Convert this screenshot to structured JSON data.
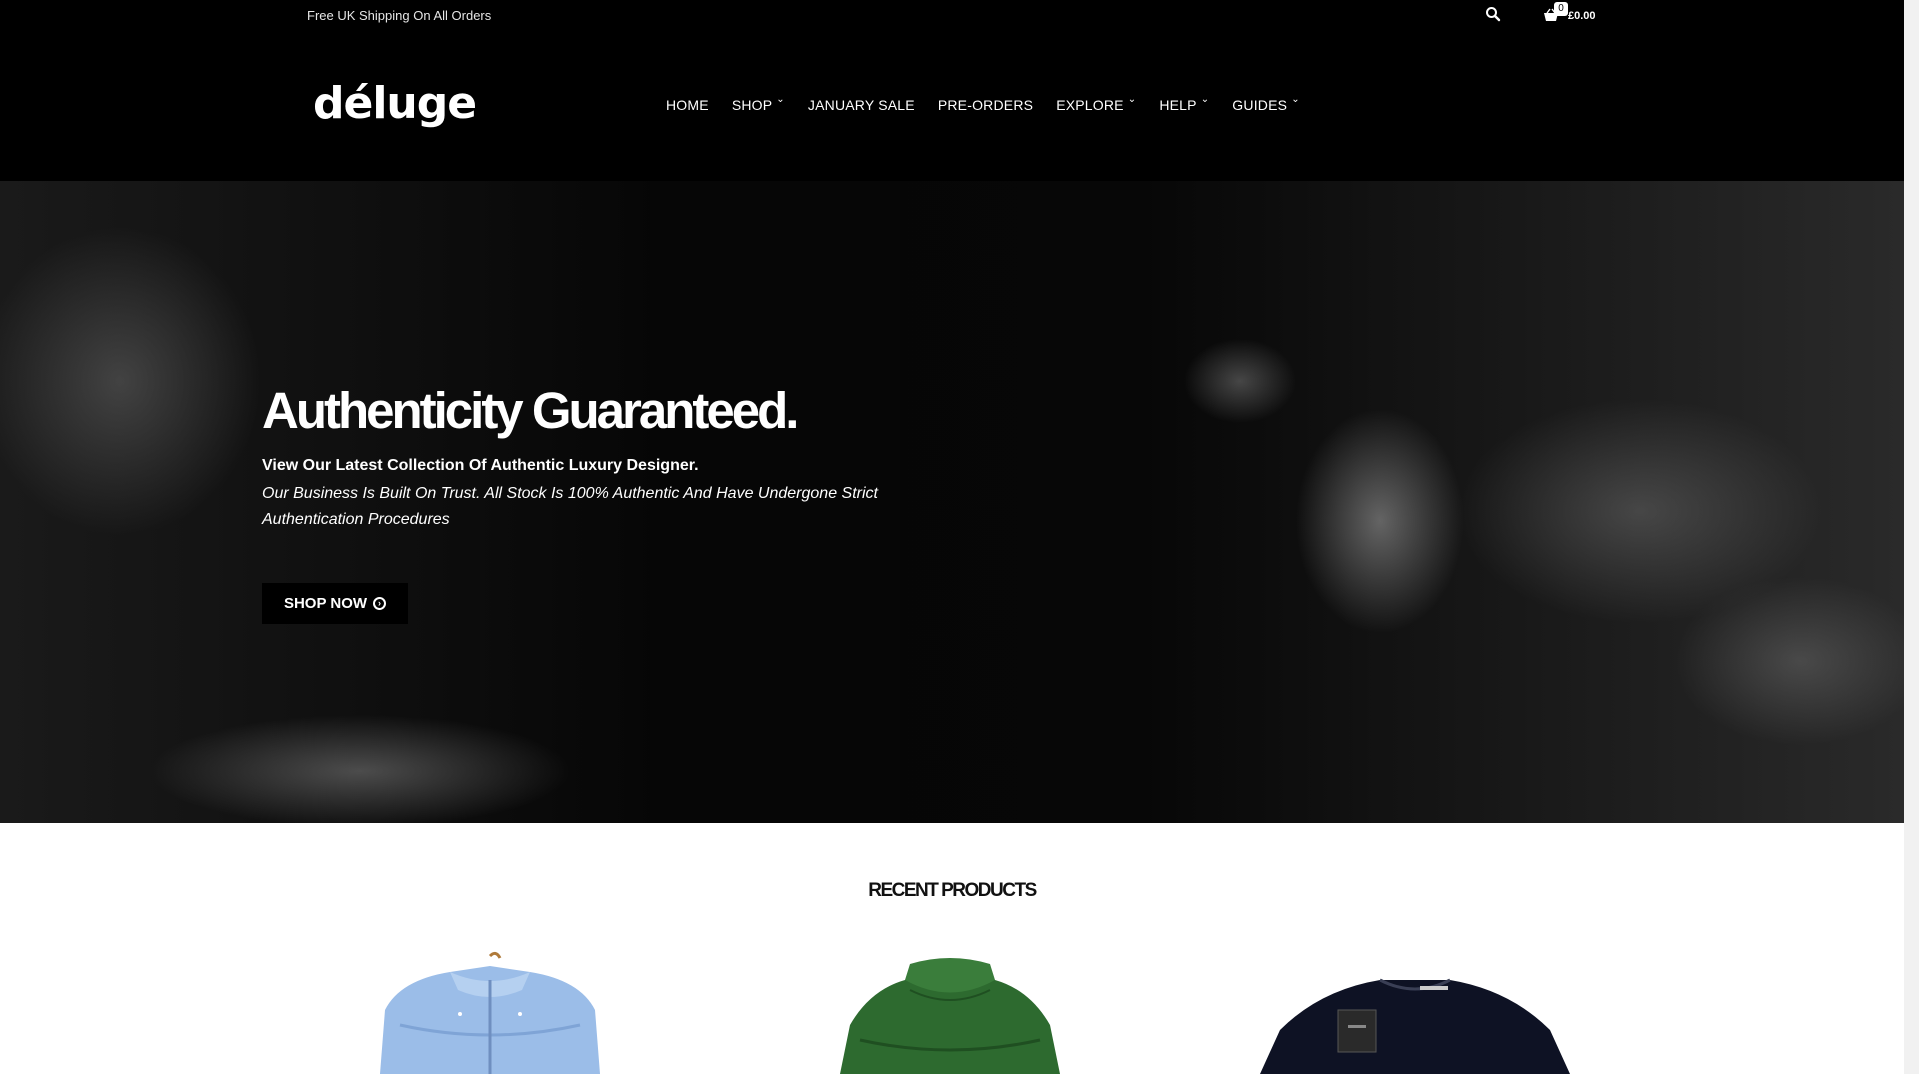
{
  "topbar": {
    "shipping_text": "Free UK Shipping On All Orders",
    "cart_count": "0",
    "cart_total": "£0.00"
  },
  "logo": "déluge",
  "nav": [
    {
      "label": "HOME",
      "dropdown": false
    },
    {
      "label": "SHOP",
      "dropdown": true
    },
    {
      "label": "JANUARY SALE",
      "dropdown": false
    },
    {
      "label": "PRE-ORDERS",
      "dropdown": false
    },
    {
      "label": "EXPLORE",
      "dropdown": true
    },
    {
      "label": "HELP",
      "dropdown": true
    },
    {
      "label": "GUIDES",
      "dropdown": true
    }
  ],
  "hero": {
    "title": "Authenticity Guaranteed.",
    "subtitle": "View Our Latest Collection Of Authentic Luxury Designer.",
    "text": "Our Business Is Built On Trust. All Stock Is 100% Authentic And Have Undergone Strict Authentication Procedures",
    "button_label": "SHOP NOW"
  },
  "products_section": {
    "title": "RECENT PRODUCTS",
    "products": [
      {
        "image": "light-blue-puffer-jacket"
      },
      {
        "image": "green-puffer-gilet"
      },
      {
        "image": "black-sweatshirt"
      }
    ]
  },
  "colors": {
    "header_bg": "#000000",
    "text_light": "#ffffff",
    "jacket_blue": "#9bbde8",
    "gilet_green": "#2d6a2f",
    "sweatshirt_black": "#0e1224"
  }
}
